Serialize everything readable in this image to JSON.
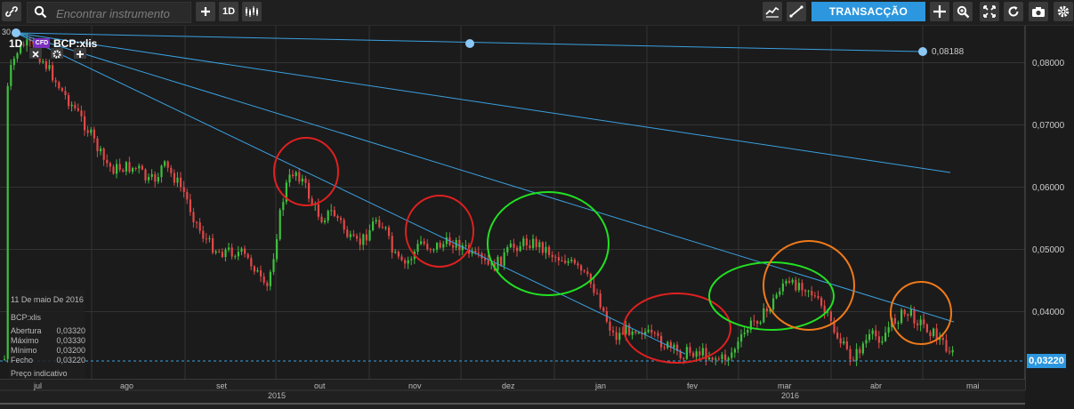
{
  "toolbar": {
    "search_placeholder": "Encontrar instrumento",
    "interval_label": "1D",
    "trade_button": "TRANSACÇÃO",
    "icons": [
      "link-icon",
      "search-icon",
      "add-icon",
      "interval-button",
      "candles-icon",
      "indicators-icon",
      "drawing-icon",
      "trade-button",
      "crosshair-icon",
      "zoom-icon",
      "fullscreen-icon",
      "refresh-icon",
      "camera-icon",
      "settings-icon"
    ]
  },
  "chart": {
    "interval": "1D",
    "cfd_badge": "CFD",
    "symbol": "BCP:xlis",
    "top_left_value": "30",
    "trendline_label": "0,08188",
    "last_price": "0,03220",
    "y_axis": [
      "0,08000",
      "0,07000",
      "0,06000",
      "0,05000",
      "0,04000"
    ],
    "x_axis": [
      "jul",
      "ago",
      "set",
      "out",
      "nov",
      "dez",
      "jan",
      "fev",
      "mar",
      "abr",
      "mai"
    ],
    "years": [
      "2015",
      "2016"
    ],
    "info_box": {
      "date": "11 De maio De 2016",
      "symbol": "BCP:xlis",
      "rows": [
        {
          "label": "Abertura",
          "value": "0,03320"
        },
        {
          "label": "Máximo",
          "value": "0,03330"
        },
        {
          "label": "Mínimo",
          "value": "0,03200"
        },
        {
          "label": "Fecho",
          "value": "0,03220"
        }
      ],
      "note": "Preço indicativo"
    },
    "colors": {
      "up": "#3fbf3f",
      "down": "#e04848",
      "trendline": "#3aa0e0",
      "circle_red": "#e02020",
      "circle_green": "#22e022",
      "circle_orange": "#f07a1a"
    }
  },
  "chart_data": {
    "type": "candlestick",
    "title": "",
    "xlabel": "",
    "ylabel": "",
    "ylim": [
      0.028,
      0.084
    ],
    "x": [
      "2015-06",
      "2015-07",
      "2015-08",
      "2015-09",
      "2015-10",
      "2015-11",
      "2015-12",
      "2016-01",
      "2016-02",
      "2016-03",
      "2016-04",
      "2016-05"
    ],
    "values": [
      0.072,
      0.079,
      0.064,
      0.05,
      0.061,
      0.05,
      0.05,
      0.041,
      0.033,
      0.043,
      0.04,
      0.0322
    ],
    "last": 0.0322
  }
}
